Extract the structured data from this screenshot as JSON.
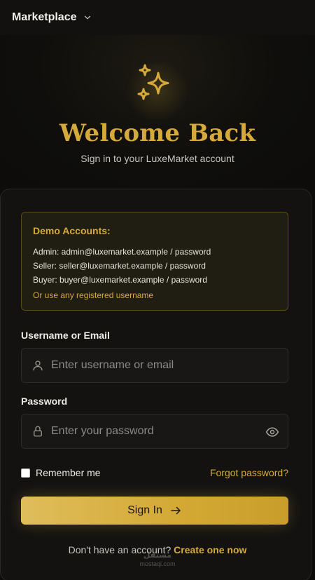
{
  "topbar": {
    "brand": "Marketplace",
    "chevron_icon": "chevron-down-icon"
  },
  "hero": {
    "icon": "sparkles-icon",
    "title": "Welcome Back",
    "subtitle": "Sign in to your LuxeMarket account"
  },
  "demo_accounts": {
    "title": "Demo Accounts:",
    "lines": [
      "Admin: admin@luxemarket.example / password",
      "Seller: seller@luxemarket.example / password",
      "Buyer: buyer@luxemarket.example / password"
    ],
    "note": "Or use any registered username"
  },
  "form": {
    "username_label": "Username or Email",
    "username_placeholder": "Enter username or email",
    "username_value": "",
    "password_label": "Password",
    "password_placeholder": "Enter your password",
    "password_value": "",
    "remember_label": "Remember me",
    "remember_checked": false,
    "forgot_label": "Forgot password?",
    "submit_label": "Sign In"
  },
  "footer": {
    "question": "Don't have an account? ",
    "link": "Create one now"
  },
  "watermark": {
    "line1": "مستقل",
    "line2": "mostaqi.com"
  },
  "colors": {
    "accent": "#d6aa3a",
    "background": "#0d0c0a",
    "card": "#131211",
    "demo_bg": "#201d12"
  }
}
